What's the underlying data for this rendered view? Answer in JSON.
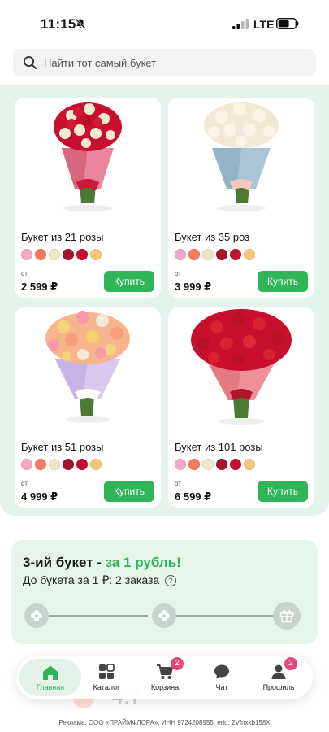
{
  "status_bar": {
    "time": "11:15",
    "network": "LTE"
  },
  "search": {
    "placeholder": "Найти тот самый букет"
  },
  "catalog": {
    "price_prefix": "от",
    "buy_label": "Купить",
    "products": [
      {
        "title": "Букет из 21 розы",
        "price": "2 599 ₽",
        "colors": [
          "#f3a9c5",
          "#f37b5e",
          "#efe6c4",
          "#a3152a",
          "#c8102e",
          "#f6c77a"
        ]
      },
      {
        "title": "Букет из 35 роз",
        "price": "3 999 ₽",
        "colors": [
          "#f3a9c5",
          "#f37b5e",
          "#efe6c4",
          "#a3152a",
          "#c8102e",
          "#f6c77a"
        ]
      },
      {
        "title": "Букет из 51 розы",
        "price": "4 999 ₽",
        "colors": [
          "#f3a9c5",
          "#f37b5e",
          "#efe6c4",
          "#a3152a",
          "#c8102e",
          "#f6c77a"
        ]
      },
      {
        "title": "Букет из 101 розы",
        "price": "6 599 ₽",
        "colors": [
          "#f3a9c5",
          "#f37b5e",
          "#efe6c4",
          "#a3152a",
          "#c8102e",
          "#f6c77a"
        ]
      }
    ]
  },
  "promo": {
    "title_main": "3-ий букет - ",
    "title_accent": "за 1 рубль!",
    "subtitle": "До букета за 1 ₽: 2 заказа",
    "info_glyph": "?"
  },
  "rating_peek": {
    "value": "4.7"
  },
  "bottom_nav": {
    "items": [
      {
        "label": "Главная",
        "icon": "home-icon",
        "active": true
      },
      {
        "label": "Каталог",
        "icon": "catalog-icon"
      },
      {
        "label": "Корзина",
        "icon": "cart-icon",
        "badge": "2"
      },
      {
        "label": "Чат",
        "icon": "chat-icon"
      },
      {
        "label": "Профиль",
        "icon": "profile-icon",
        "badge": "2"
      }
    ]
  },
  "ad_footer": "Реклама. ООО «ПРАЙМФЛОРА». ИНН 9724208955. erid: 2Vfnxxb158X",
  "colors": {
    "accent": "#2fb457",
    "badge": "#e6467a",
    "catalog_bg": "#e4f4ea"
  }
}
